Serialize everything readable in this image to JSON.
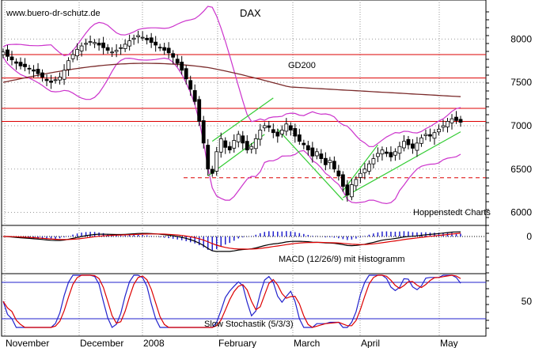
{
  "chart_data": {
    "type": "candlestick",
    "title": "DAX",
    "watermark": "www.buero-dr-schutz.de",
    "source_note": "Hoppenstedt Charts",
    "colors": {
      "background": "#ffffff",
      "grid": "#999999",
      "candle": "#000000",
      "bollinger": "#cc33cc",
      "ma200": "#7a2a2a",
      "horizontal_levels": "#dd0000",
      "trend_channels": "#33cc33",
      "macd": "#000000",
      "macd_signal": "#dd0000",
      "histogram": "#2222cc",
      "stoch_k": "#2222cc",
      "stoch_d": "#dd0000",
      "stoch_bands": "#2222cc"
    },
    "x_axis": {
      "months": [
        "November",
        "December",
        "2008",
        "February",
        "March",
        "April",
        "May"
      ]
    },
    "price_panel": {
      "y_ticks": [
        6000,
        6500,
        7000,
        7500,
        8000
      ],
      "ylim": [
        5850,
        8450
      ],
      "ma200_label": "GD200",
      "horizontal_levels": [
        7820,
        7550,
        7200,
        7050
      ],
      "dashed_support": 6400,
      "closes": [
        7850,
        7800,
        7760,
        7720,
        7690,
        7680,
        7660,
        7630,
        7600,
        7560,
        7520,
        7500,
        7530,
        7560,
        7640,
        7750,
        7820,
        7880,
        7920,
        7950,
        7970,
        7960,
        7930,
        7900,
        7870,
        7850,
        7870,
        7900,
        7940,
        7980,
        8010,
        8040,
        8020,
        7990,
        7960,
        7930,
        7900,
        7870,
        7840,
        7790,
        7720,
        7640,
        7540,
        7420,
        7280,
        7050,
        6800,
        6500,
        6450,
        6700,
        6850,
        6750,
        6720,
        6830,
        6900,
        6800,
        6720,
        6760,
        6850,
        6950,
        7000,
        6980,
        6920,
        6880,
        6950,
        7020,
        6950,
        6880,
        6820,
        6780,
        6720,
        6650,
        6700,
        6620,
        6550,
        6600,
        6500,
        6420,
        6300,
        6200,
        6320,
        6380,
        6450,
        6500,
        6560,
        6620,
        6680,
        6720,
        6680,
        6640,
        6700,
        6760,
        6820,
        6780,
        6740,
        6800,
        6860,
        6900,
        6880,
        6920,
        6960,
        7000,
        7050,
        7080,
        7060,
        7040
      ]
    },
    "macd_panel": {
      "title": "MACD (12/26/9) mit Histogramm",
      "y_ticks": [
        0
      ]
    },
    "stochastic_panel": {
      "title": "Slow Stochastik (5/3/3)",
      "y_ticks": [
        50
      ]
    }
  }
}
